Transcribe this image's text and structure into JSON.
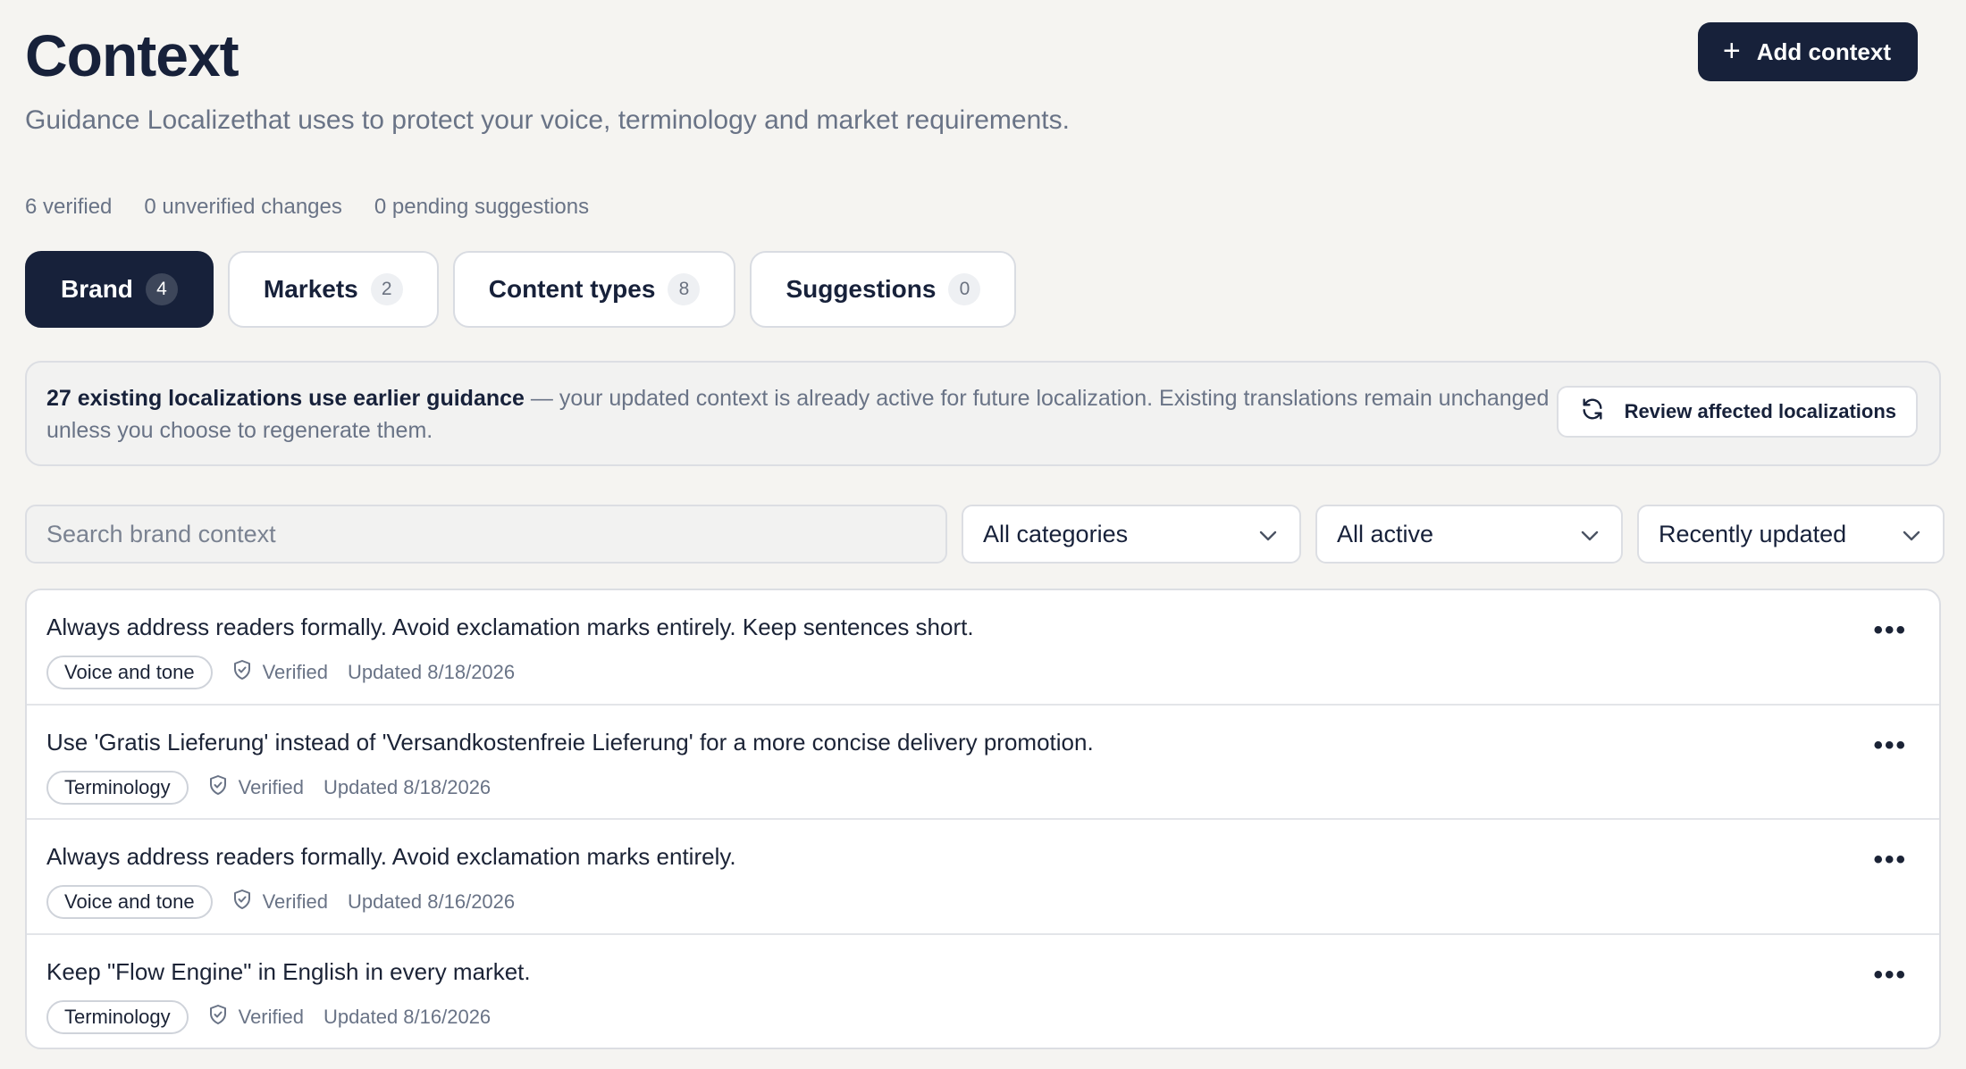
{
  "header": {
    "title": "Context",
    "subtitle": "Guidance Localizethat uses to protect your voice, terminology and market requirements.",
    "add_button": "Add context"
  },
  "stats": {
    "verified": "6 verified",
    "unverified": "0 unverified changes",
    "pending": "0 pending suggestions"
  },
  "tabs": [
    {
      "label": "Brand",
      "count": "4"
    },
    {
      "label": "Markets",
      "count": "2"
    },
    {
      "label": "Content types",
      "count": "8"
    },
    {
      "label": "Suggestions",
      "count": "0"
    }
  ],
  "notice": {
    "strong": "27 existing localizations use earlier guidance",
    "text": " — your updated context is already active for future localization. Existing translations remain unchanged unless you choose to regenerate them.",
    "button": "Review affected localizations"
  },
  "filters": {
    "search_placeholder": "Search brand context",
    "category": "All categories",
    "status": "All active",
    "sort": "Recently updated"
  },
  "items": [
    {
      "text": "Always address readers formally. Avoid exclamation marks entirely. Keep sentences short.",
      "tag": "Voice and tone",
      "status": "Verified",
      "updated": "Updated 8/18/2026"
    },
    {
      "text": "Use 'Gratis Lieferung' instead of 'Versandkostenfreie Lieferung' for a more concise delivery promotion.",
      "tag": "Terminology",
      "status": "Verified",
      "updated": "Updated 8/18/2026"
    },
    {
      "text": "Always address readers formally. Avoid exclamation marks entirely.",
      "tag": "Voice and tone",
      "status": "Verified",
      "updated": "Updated 8/16/2026"
    },
    {
      "text": "Keep \"Flow Engine\" in English in every market.",
      "tag": "Terminology",
      "status": "Verified",
      "updated": "Updated 8/16/2026"
    }
  ],
  "icons": {
    "add": "plus-icon",
    "review": "refresh-icon",
    "select": "chevron-down-icon",
    "verified": "shield-check-icon",
    "more": "more-horizontal-icon"
  },
  "colors": {
    "primary": "#17213a",
    "background": "#f5f4f1",
    "muted_text": "#697386"
  }
}
